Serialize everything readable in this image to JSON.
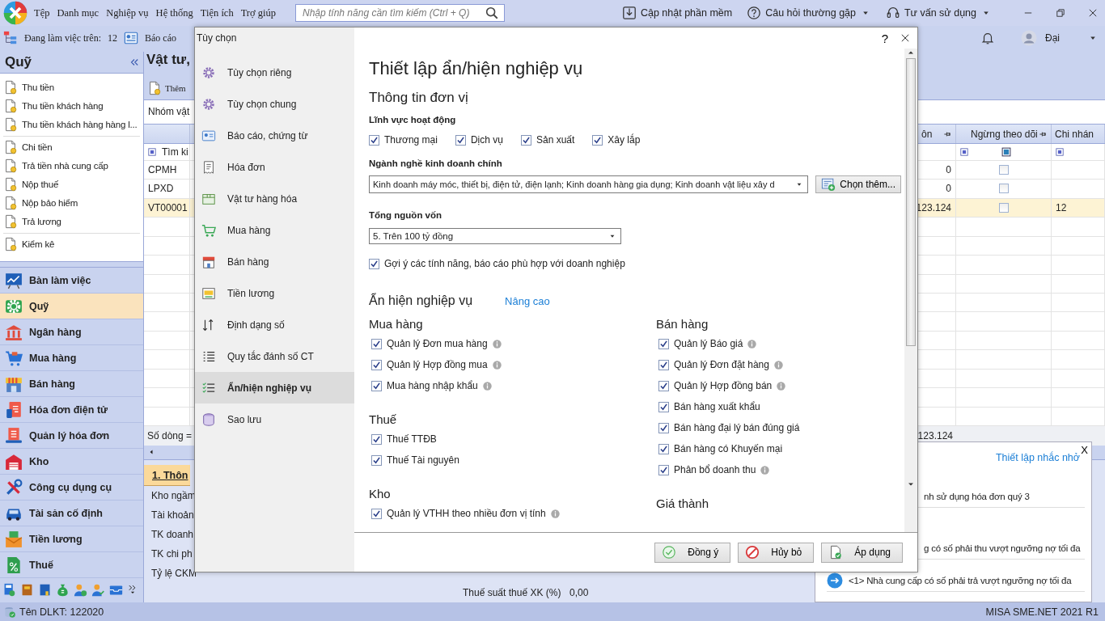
{
  "menu_bar": {
    "menus": [
      "Tệp",
      "Danh mục",
      "Nghiệp vụ",
      "Hệ thống",
      "Tiện ích",
      "Trợ giúp"
    ],
    "search": {
      "placeholder": "Nhập tính năng cần tìm kiếm (Ctrl + Q)"
    },
    "actions": [
      {
        "label": "Cập nhật phần mềm",
        "dropdown": false
      },
      {
        "label": "Câu hỏi thường gặp",
        "dropdown": true
      },
      {
        "label": "Tư vấn sử dụng",
        "dropdown": true
      }
    ]
  },
  "toolbar": {
    "working_on_label": "Đang làm việc trên:",
    "working_on_value": "12",
    "report": "Báo cáo",
    "user": "Đại"
  },
  "sidebar": {
    "title": "Quỹ",
    "groups": [
      [
        "Thu tiền",
        "Thu tiền khách hàng",
        "Thu tiền khách hàng hàng l..."
      ],
      [
        "Chi tiền",
        "Trả tiền nhà cung cấp",
        "Nộp thuế",
        "Nộp bảo hiểm",
        "Trả lương"
      ],
      [
        "Kiểm kê"
      ]
    ],
    "modules": [
      {
        "label": "Bàn làm việc",
        "selected": false
      },
      {
        "label": "Quỹ",
        "selected": true
      },
      {
        "label": "Ngân hàng",
        "selected": false
      },
      {
        "label": "Mua hàng",
        "selected": false
      },
      {
        "label": "Bán hàng",
        "selected": false
      },
      {
        "label": "Hóa đơn điện tử",
        "selected": false
      },
      {
        "label": "Quản lý hóa đơn",
        "selected": false
      },
      {
        "label": "Kho",
        "selected": false
      },
      {
        "label": "Công cụ dụng cụ",
        "selected": false
      },
      {
        "label": "Tài sản cố định",
        "selected": false
      },
      {
        "label": "Tiền lương",
        "selected": false
      },
      {
        "label": "Thuế",
        "selected": false
      }
    ]
  },
  "list_view": {
    "title": "Vật tư,",
    "add_button": "Thêm",
    "group_label": "Nhóm vật",
    "search_label": "Tìm ki",
    "columns": [
      "ôn",
      "Ngừng theo dõi",
      "Chi nhán"
    ],
    "rows": [
      {
        "code": "CPMH",
        "column_1": "0",
        "stop_tracking": false,
        "selected": false
      },
      {
        "code": "LPXD",
        "column_1": "0",
        "stop_tracking": false,
        "selected": false
      },
      {
        "code": "VT00001",
        "column_1": "123.124",
        "stop_tracking": false,
        "branch": "12",
        "selected": true
      }
    ],
    "footer_label": "Số dòng =",
    "footer_total": "123.124"
  },
  "detail_panel": {
    "tab": "1. Thôn",
    "fields": [
      "Kho ngầm",
      "Tài khoản",
      "TK doanh",
      "TK chi ph",
      "Tỷ lệ CKM"
    ],
    "tax_label": "Thuế suất thuế XK (%)",
    "tax_value": "0,00"
  },
  "reminders": {
    "settings_link": "Thiết lập nhắc nhở",
    "close": "X",
    "items": [
      "nh sử dụng hóa đơn quý 3",
      "g có số phải thu vượt ngưỡng nợ tối đa",
      "<1> Nhà cung cấp có số phải trả vượt ngưỡng nợ tối đa"
    ]
  },
  "dialog": {
    "title": "Tùy chọn",
    "help": "?",
    "nav": [
      {
        "label": "Tùy chọn riêng",
        "selected": false
      },
      {
        "label": "Tùy chọn chung",
        "selected": false
      },
      {
        "label": "Báo cáo, chứng từ",
        "selected": false
      },
      {
        "label": "Hóa đơn",
        "selected": false
      },
      {
        "label": "Vật tư hàng hóa",
        "selected": false
      },
      {
        "label": "Mua hàng",
        "selected": false
      },
      {
        "label": "Bán hàng",
        "selected": false
      },
      {
        "label": "Tiền lương",
        "selected": false
      },
      {
        "label": "Định dạng số",
        "selected": false
      },
      {
        "label": "Quy tắc đánh số CT",
        "selected": false
      },
      {
        "label": "Ẩn/hiện nghiệp vụ",
        "selected": true
      },
      {
        "label": "Sao lưu",
        "selected": false
      }
    ],
    "heading": "Thiết lập ẩn/hiện nghiệp vụ",
    "subheading": "Thông tin đơn vị",
    "business_fields_label": "Lĩnh vực hoạt động",
    "business_fields": [
      {
        "label": "Thương mại",
        "checked": true
      },
      {
        "label": "Dịch vụ",
        "checked": true
      },
      {
        "label": "Sản xuất",
        "checked": true
      },
      {
        "label": "Xây lắp",
        "checked": true
      }
    ],
    "main_business_label": "Ngành nghề kinh doanh chính",
    "main_business_value": "Kinh doanh máy móc, thiết bị, điện tử, điện lạnh; Kinh doanh hàng gia dụng; Kinh doanh vật liệu xây d",
    "choose_more": "Chọn thêm...",
    "capital_label": "Tổng nguồn vốn",
    "capital_value": "5. Trên 100 tỷ đồng",
    "suggest": {
      "label": "Gợi ý các tính năng, báo cáo phù hợp với doanh nghiệp",
      "checked": true
    },
    "features_title": "Ẩn hiện nghiệp vụ",
    "advanced_link": "Nâng cao",
    "columns": [
      [
        {
          "title": "Mua hàng",
          "items": [
            {
              "label": "Quản lý Đơn mua hàng",
              "checked": true,
              "info": true
            },
            {
              "label": "Quản lý Hợp đồng mua",
              "checked": true,
              "info": true
            },
            {
              "label": "Mua hàng nhập khẩu",
              "checked": true,
              "info": true
            }
          ]
        },
        {
          "title": "Thuế",
          "items": [
            {
              "label": "Thuế TTĐB",
              "checked": true,
              "info": false
            },
            {
              "label": "Thuế Tài nguyên",
              "checked": true,
              "info": false
            }
          ]
        },
        {
          "title": "Kho",
          "items": [
            {
              "label": "Quản lý VTHH theo nhiều đơn vị tính",
              "checked": true,
              "info": true
            }
          ]
        }
      ],
      [
        {
          "title": "Bán hàng",
          "items": [
            {
              "label": "Quản lý Báo giá",
              "checked": true,
              "info": true
            },
            {
              "label": "Quản lý Đơn đặt hàng",
              "checked": true,
              "info": true
            },
            {
              "label": "Quản lý Hợp đồng bán",
              "checked": true,
              "info": true
            },
            {
              "label": "Bán hàng xuất khẩu",
              "checked": true,
              "info": false
            },
            {
              "label": "Bán hàng đại lý bán đúng giá",
              "checked": true,
              "info": false
            },
            {
              "label": "Bán hàng có Khuyến mại",
              "checked": true,
              "info": false
            },
            {
              "label": "Phân bổ doanh thu",
              "checked": true,
              "info": true
            }
          ]
        },
        {
          "title": "Giá thành"
        }
      ]
    ],
    "buttons": [
      "Đồng ý",
      "Hủy bỏ",
      "Áp dụng"
    ]
  },
  "status_bar": {
    "db_name": "Tên DLKT: 122020",
    "version": "MISA SME.NET 2021 R1"
  }
}
